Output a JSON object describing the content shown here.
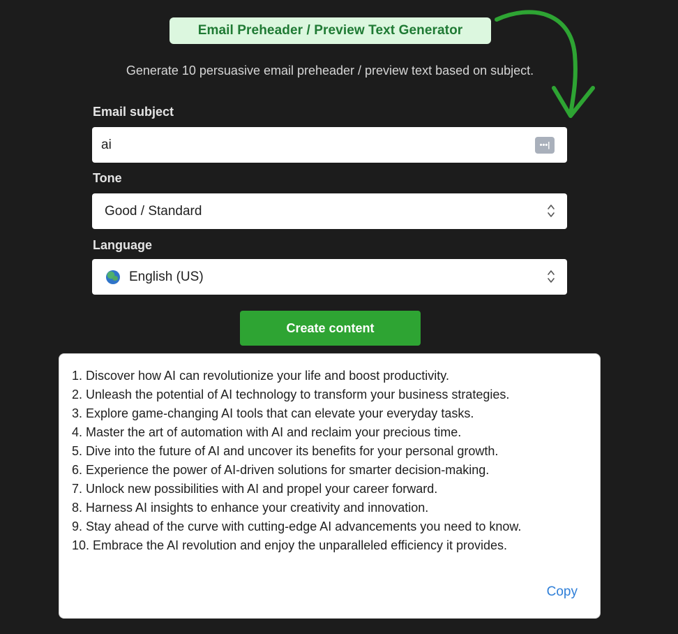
{
  "header": {
    "title": "Email Preheader / Preview Text Generator",
    "subtitle": "Generate 10 persuasive email preheader / preview text based on subject."
  },
  "form": {
    "subject": {
      "label": "Email subject",
      "value": "ai",
      "action_icon": "ellipsis-icon"
    },
    "tone": {
      "label": "Tone",
      "selected": "Good / Standard"
    },
    "language": {
      "label": "Language",
      "selected": "English (US)",
      "icon": "globe-icon"
    },
    "submit_label": "Create content"
  },
  "result": {
    "items": [
      "1. Discover how AI can revolutionize your life and boost productivity.",
      "2. Unleash the potential of AI technology to transform your business strategies.",
      "3. Explore game-changing AI tools that can elevate your everyday tasks.",
      "4. Master the art of automation with AI and reclaim your precious time.",
      "5. Dive into the future of AI and uncover its benefits for your personal growth.",
      "6. Experience the power of AI-driven solutions for smarter decision-making.",
      "7. Unlock new possibilities with AI and propel your career forward.",
      "8. Harness AI insights to enhance your creativity and innovation.",
      "9. Stay ahead of the curve with cutting-edge AI advancements you need to know.",
      "10. Embrace the AI revolution and enjoy the unparalleled efficiency it provides."
    ],
    "copy_label": "Copy"
  },
  "colors": {
    "background": "#1c1c1c",
    "accent_green": "#2ea433",
    "badge_bg": "#dcf7df",
    "link_blue": "#2f7fd8"
  }
}
